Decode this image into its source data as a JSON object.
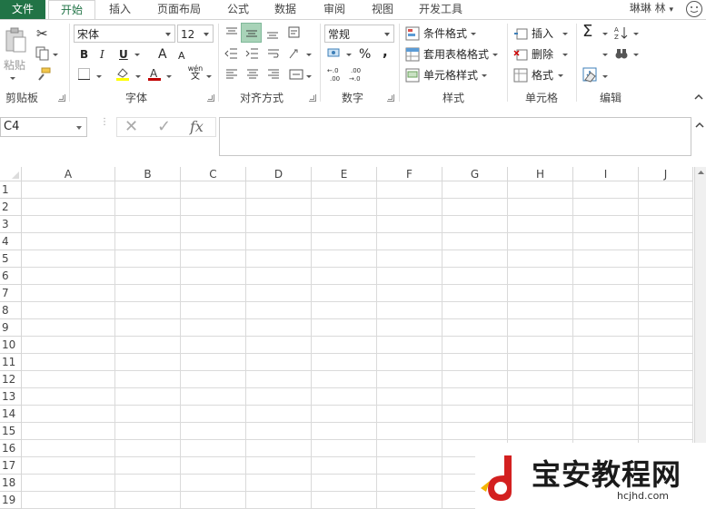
{
  "tabs": [
    "文件",
    "开始",
    "插入",
    "页面布局",
    "公式",
    "数据",
    "审阅",
    "视图",
    "开发工具"
  ],
  "user": "琳琳 林",
  "ribbon": {
    "clipboard": {
      "paste": "粘贴",
      "label": "剪贴板"
    },
    "font": {
      "name": "宋体",
      "size": "12",
      "bold": "B",
      "italic": "I",
      "underline": "U",
      "grow": "A",
      "shrink": "A",
      "phonetic_top": "wén",
      "phonetic_bottom": "文",
      "label": "字体"
    },
    "alignment": {
      "label": "对齐方式"
    },
    "number": {
      "format": "常规",
      "percent": "%",
      "comma": ",",
      "inc_dec": "+.0 .00",
      "dec_dec": ".00 →.0",
      "label": "数字"
    },
    "styles": {
      "conditional": "条件格式",
      "table": "套用表格格式",
      "cell": "单元格样式",
      "label": "样式"
    },
    "cells": {
      "insert": "插入",
      "delete": "删除",
      "format": "格式",
      "label": "单元格"
    },
    "editing": {
      "sum": "Σ",
      "label": "编辑"
    },
    "colors": {
      "accent": "#217346",
      "align_active": "#a8d3b8"
    }
  },
  "formula_bar": {
    "name_box": "C4",
    "cancel": "✕",
    "enter": "✓",
    "fx": "fx",
    "value": ""
  },
  "sheet": {
    "columns": [
      "A",
      "B",
      "C",
      "D",
      "E",
      "F",
      "G",
      "H",
      "I",
      "J"
    ],
    "rows": [
      "1",
      "2",
      "3",
      "4",
      "5",
      "6",
      "7",
      "8",
      "9",
      "10",
      "11",
      "12",
      "13",
      "14",
      "15",
      "16",
      "17",
      "18",
      "19"
    ]
  },
  "watermark": {
    "title": "宝安教程网",
    "url": "hcjhd.com"
  }
}
